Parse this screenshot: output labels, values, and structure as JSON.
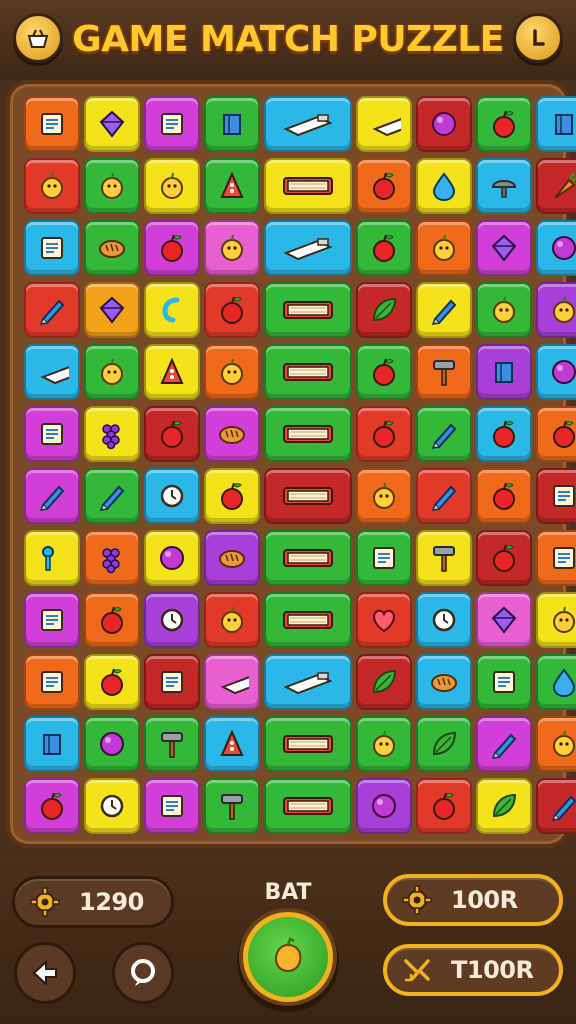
{
  "header": {
    "title": "GAME MATCH PUZZLE",
    "left_button_icon": "basket-icon",
    "right_button_icon": "info-icon"
  },
  "board": {
    "columns": 9,
    "rows": 12,
    "wide_column_index": 4,
    "tiles": [
      [
        {
          "c": "#f06a1c",
          "i": "card"
        },
        {
          "c": "#f4e21a",
          "i": "gem"
        },
        {
          "c": "#d23fd8",
          "i": "card"
        },
        {
          "c": "#33b83a",
          "i": "box"
        },
        {
          "c": "#2bb7e8",
          "i": "bottle"
        },
        {
          "c": "#f4e21a",
          "i": "bottle"
        },
        {
          "c": "#c42828",
          "i": "ball"
        },
        {
          "c": "#33b83a",
          "i": "apple"
        },
        {
          "c": "#2bb7e8",
          "i": "box"
        }
      ],
      [
        {
          "c": "#e23a2a",
          "i": "fruit"
        },
        {
          "c": "#33b83a",
          "i": "fruit"
        },
        {
          "c": "#f4e21a",
          "i": "fruit"
        },
        {
          "c": "#33b83a",
          "i": "cone"
        },
        {
          "c": "#f4e21a",
          "i": "book"
        },
        {
          "c": "#f06a1c",
          "i": "apple"
        },
        {
          "c": "#f4e21a",
          "i": "drop"
        },
        {
          "c": "#2bb7e8",
          "i": "cap"
        },
        {
          "c": "#c42828",
          "i": "carrot"
        }
      ],
      [
        {
          "c": "#2bb7e8",
          "i": "card"
        },
        {
          "c": "#33b83a",
          "i": "bread"
        },
        {
          "c": "#d23fd8",
          "i": "apple"
        },
        {
          "c": "#e85fd2",
          "i": "fruit"
        },
        {
          "c": "#2bb7e8",
          "i": "bottle"
        },
        {
          "c": "#33b83a",
          "i": "apple"
        },
        {
          "c": "#f06a1c",
          "i": "fruit"
        },
        {
          "c": "#d23fd8",
          "i": "gem"
        },
        {
          "c": "#2bb7e8",
          "i": "ball"
        }
      ],
      [
        {
          "c": "#e23a2a",
          "i": "pencil"
        },
        {
          "c": "#f4a21a",
          "i": "gem"
        },
        {
          "c": "#f4e21a",
          "i": "hook"
        },
        {
          "c": "#e23a2a",
          "i": "apple"
        },
        {
          "c": "#33b83a",
          "i": "book"
        },
        {
          "c": "#c42828",
          "i": "leaf"
        },
        {
          "c": "#f4e21a",
          "i": "pencil"
        },
        {
          "c": "#33b83a",
          "i": "fruit"
        },
        {
          "c": "#a83fd8",
          "i": "fruit"
        }
      ],
      [
        {
          "c": "#2bb7e8",
          "i": "bottle"
        },
        {
          "c": "#33b83a",
          "i": "fruit"
        },
        {
          "c": "#f4e21a",
          "i": "cone"
        },
        {
          "c": "#f06a1c",
          "i": "fruit"
        },
        {
          "c": "#33b83a",
          "i": "book"
        },
        {
          "c": "#33b83a",
          "i": "apple"
        },
        {
          "c": "#f06a1c",
          "i": "hammer"
        },
        {
          "c": "#a83fd8",
          "i": "box"
        },
        {
          "c": "#2bb7e8",
          "i": "ball"
        }
      ],
      [
        {
          "c": "#d23fd8",
          "i": "card"
        },
        {
          "c": "#f4e21a",
          "i": "grape"
        },
        {
          "c": "#c42828",
          "i": "apple"
        },
        {
          "c": "#d23fd8",
          "i": "bread"
        },
        {
          "c": "#33b83a",
          "i": "book"
        },
        {
          "c": "#e23a2a",
          "i": "apple"
        },
        {
          "c": "#33b83a",
          "i": "pencil"
        },
        {
          "c": "#2bb7e8",
          "i": "apple"
        },
        {
          "c": "#f06a1c",
          "i": "apple"
        }
      ],
      [
        {
          "c": "#d23fd8",
          "i": "pencil"
        },
        {
          "c": "#33b83a",
          "i": "pencil"
        },
        {
          "c": "#2bb7e8",
          "i": "clock"
        },
        {
          "c": "#f4e21a",
          "i": "apple"
        },
        {
          "c": "#c42828",
          "i": "book"
        },
        {
          "c": "#f06a1c",
          "i": "fruit"
        },
        {
          "c": "#e23a2a",
          "i": "pencil"
        },
        {
          "c": "#f06a1c",
          "i": "apple"
        },
        {
          "c": "#c42828",
          "i": "card"
        }
      ],
      [
        {
          "c": "#f4e21a",
          "i": "key"
        },
        {
          "c": "#f06a1c",
          "i": "grape"
        },
        {
          "c": "#f4e21a",
          "i": "ball"
        },
        {
          "c": "#a83fd8",
          "i": "bread"
        },
        {
          "c": "#33b83a",
          "i": "book"
        },
        {
          "c": "#33b83a",
          "i": "card"
        },
        {
          "c": "#f4e21a",
          "i": "hammer"
        },
        {
          "c": "#c42828",
          "i": "apple"
        },
        {
          "c": "#f06a1c",
          "i": "card"
        }
      ],
      [
        {
          "c": "#d23fd8",
          "i": "card"
        },
        {
          "c": "#f06a1c",
          "i": "apple"
        },
        {
          "c": "#a83fd8",
          "i": "clock"
        },
        {
          "c": "#e23a2a",
          "i": "fruit"
        },
        {
          "c": "#33b83a",
          "i": "book"
        },
        {
          "c": "#e23a2a",
          "i": "heart"
        },
        {
          "c": "#2bb7e8",
          "i": "clock"
        },
        {
          "c": "#e85fd2",
          "i": "gem"
        },
        {
          "c": "#f4e21a",
          "i": "fruit"
        }
      ],
      [
        {
          "c": "#f06a1c",
          "i": "card"
        },
        {
          "c": "#f4e21a",
          "i": "apple"
        },
        {
          "c": "#c42828",
          "i": "card"
        },
        {
          "c": "#e85fd2",
          "i": "bottle"
        },
        {
          "c": "#2bb7e8",
          "i": "bottle"
        },
        {
          "c": "#c42828",
          "i": "leaf"
        },
        {
          "c": "#2bb7e8",
          "i": "bread"
        },
        {
          "c": "#33b83a",
          "i": "card"
        },
        {
          "c": "#33b83a",
          "i": "drop"
        }
      ],
      [
        {
          "c": "#2bb7e8",
          "i": "box"
        },
        {
          "c": "#33b83a",
          "i": "ball"
        },
        {
          "c": "#33b83a",
          "i": "hammer"
        },
        {
          "c": "#2bb7e8",
          "i": "cone"
        },
        {
          "c": "#33b83a",
          "i": "book"
        },
        {
          "c": "#33b83a",
          "i": "fruit"
        },
        {
          "c": "#33b83a",
          "i": "leaf"
        },
        {
          "c": "#d23fd8",
          "i": "pencil"
        },
        {
          "c": "#f06a1c",
          "i": "fruit"
        }
      ],
      [
        {
          "c": "#d23fd8",
          "i": "apple"
        },
        {
          "c": "#f4e21a",
          "i": "clock"
        },
        {
          "c": "#d23fd8",
          "i": "card"
        },
        {
          "c": "#33b83a",
          "i": "hammer"
        },
        {
          "c": "#33b83a",
          "i": "book"
        },
        {
          "c": "#a83fd8",
          "i": "ball"
        },
        {
          "c": "#e23a2a",
          "i": "apple"
        },
        {
          "c": "#f4e21a",
          "i": "leaf"
        },
        {
          "c": "#c42828",
          "i": "pencil"
        }
      ]
    ]
  },
  "footer": {
    "score": "1290",
    "score_icon": "gear-icon",
    "center_label": "BAT",
    "center_button_icon": "fruit-icon",
    "right_top_value": "100R",
    "right_top_icon": "gear-icon",
    "right_bottom_value": "T100R",
    "right_bottom_icon": "shuffle-icon",
    "back_icon": "back-arrow-icon",
    "hint_icon": "hint-icon",
    "accent": "#f1b21e"
  }
}
